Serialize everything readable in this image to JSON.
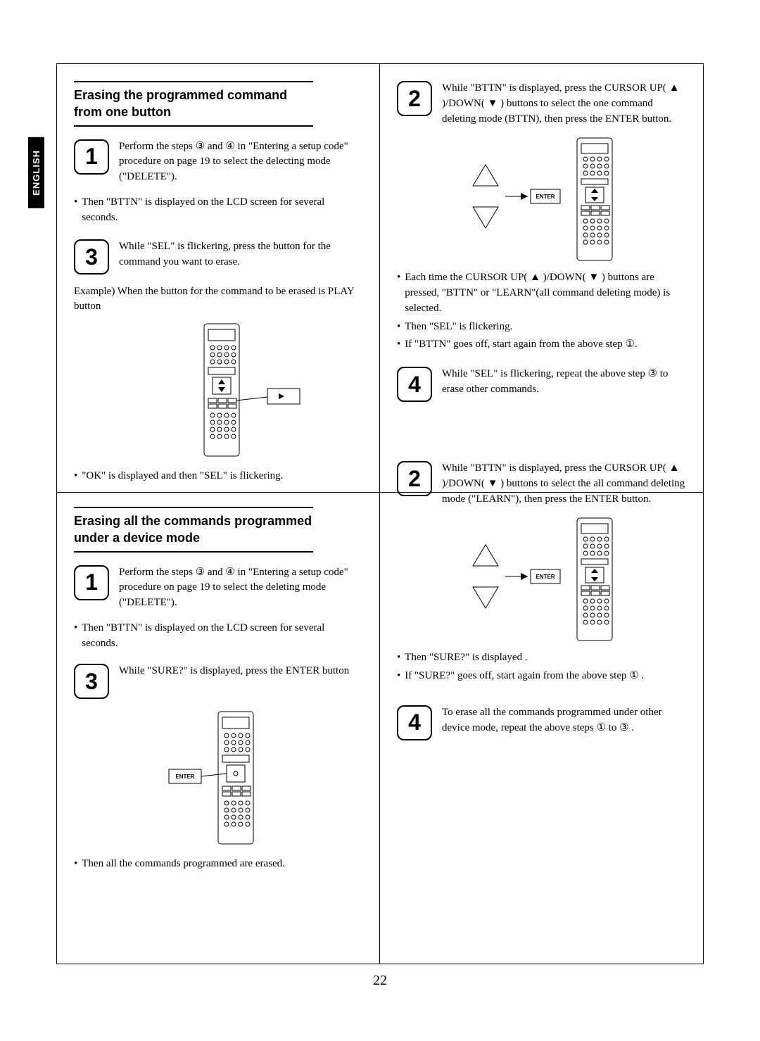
{
  "lang_tab": "ENGLISH",
  "page_number": "22",
  "section_a": {
    "title": "Erasing the programmed command from one button",
    "step1": "Perform the steps ③ and ④ in \"Entering a setup code\" procedure on page 19 to select the delecting mode (\"DELETE\").",
    "note1": "Then \"BTTN\" is displayed on the LCD screen for several seconds.",
    "step3": "While \"SEL\" is flickering, press the button for the command you want to erase.",
    "example": "Example) When the button for the command to be erased is PLAY button",
    "note2": "\"OK\" is displayed and then \"SEL\" is flickering.",
    "right_step2": "While \"BTTN\" is displayed, press the CURSOR UP( ▲ )/DOWN( ▼ ) buttons to select the one command deleting mode (BTTN), then press the ENTER button.",
    "right_b1": "Each time the CURSOR UP( ▲ )/DOWN( ▼ ) buttons are pressed, \"BTTN\" or \"LEARN\"(all command deleting mode) is selected.",
    "right_b2": "Then \"SEL\" is flickering.",
    "right_b3": "If \"BTTN\" goes off, start again from the above step ①.",
    "right_step4": "While \"SEL\" is flickering, repeat the above step ③ to erase other commands."
  },
  "section_b": {
    "title": "Erasing all the commands programmed under a device mode",
    "step1": "Perform the steps ③ and ④ in \"Entering a setup code\" procedure on page 19 to select the deleting mode (\"DELETE\").",
    "note1": "Then \"BTTN\" is displayed on the LCD screen for several seconds.",
    "step3": "While \"SURE?\" is displayed, press the ENTER button",
    "note2": "Then all the commands programmed are erased.",
    "right_step2": "While \"BTTN\" is displayed, press the CURSOR UP( ▲ )/DOWN( ▼ ) buttons to select the all command deleting mode (\"LEARN\"), then press the ENTER button.",
    "right_b1": "Then \"SURE?\" is displayed .",
    "right_b2": "If \"SURE?\" goes off, start again from the above step ① .",
    "right_step4": "To erase all the commands programmed under other device mode, repeat the above steps ① to ③ ."
  },
  "labels": {
    "enter": "ENTER",
    "n1": "1",
    "n2": "2",
    "n3": "3",
    "n4": "4"
  }
}
